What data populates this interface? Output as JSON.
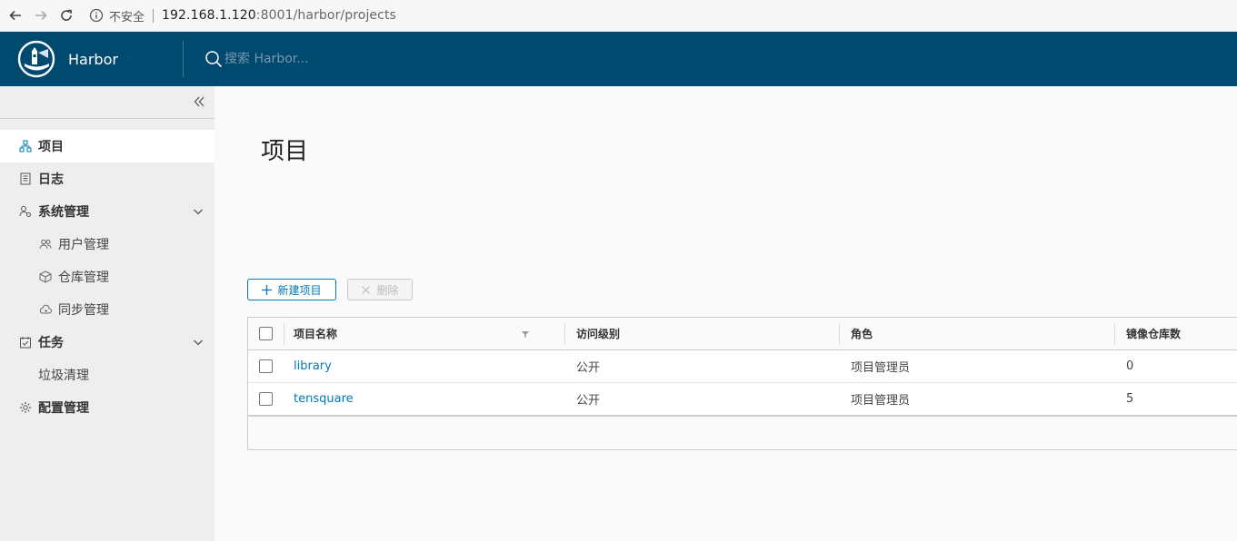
{
  "browser": {
    "insecure_label": "不安全",
    "url_host": "192.168.1.120",
    "url_rest": ":8001/harbor/projects"
  },
  "header": {
    "brand_name": "Harbor",
    "search_placeholder": "搜索 Harbor..."
  },
  "sidebar": {
    "items": [
      {
        "label": "项目",
        "icon": "projects-icon",
        "active": true
      },
      {
        "label": "日志",
        "icon": "logs-icon"
      },
      {
        "label": "系统管理",
        "icon": "admin-icon",
        "expanded": true,
        "children": [
          {
            "label": "用户管理",
            "icon": "users-icon"
          },
          {
            "label": "仓库管理",
            "icon": "registry-icon"
          },
          {
            "label": "同步管理",
            "icon": "replication-icon"
          }
        ]
      },
      {
        "label": "任务",
        "icon": "tasks-icon",
        "expanded": true,
        "children": [
          {
            "label": "垃圾清理"
          }
        ]
      },
      {
        "label": "配置管理",
        "icon": "gear-icon"
      }
    ]
  },
  "main": {
    "title": "项目",
    "new_project_label": "新建项目",
    "delete_label": "删除",
    "columns": [
      "项目名称",
      "访问级别",
      "角色",
      "镜像仓库数"
    ],
    "rows": [
      {
        "name": "library",
        "access": "公开",
        "role": "项目管理员",
        "repos": "0"
      },
      {
        "name": "tensquare",
        "access": "公开",
        "role": "项目管理员",
        "repos": "5"
      }
    ]
  },
  "colors": {
    "header_bg": "#004a70",
    "accent": "#0079b8",
    "sidebar_bg": "#eeeeee"
  }
}
